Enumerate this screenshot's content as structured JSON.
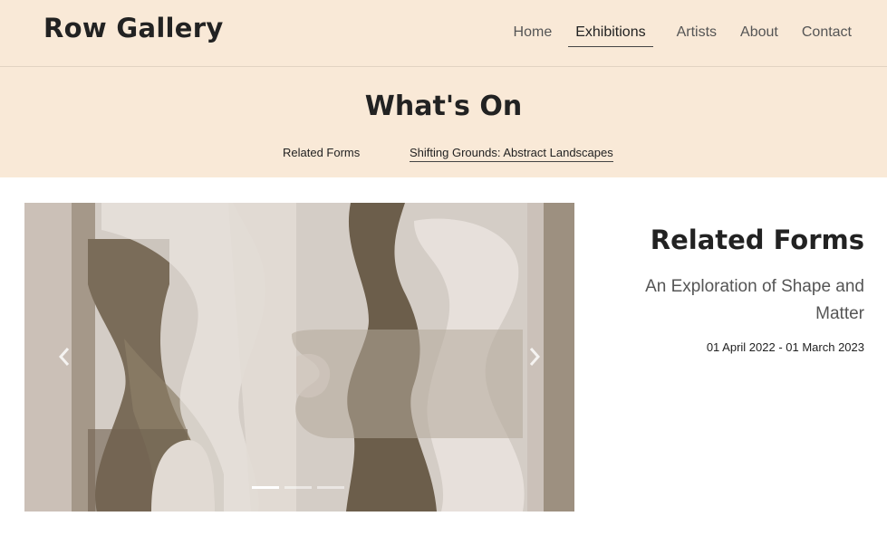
{
  "header": {
    "logo": "Row Gallery",
    "nav": [
      {
        "label": "Home"
      },
      {
        "label": "Exhibitions"
      },
      {
        "label": "Artists"
      },
      {
        "label": "About"
      },
      {
        "label": "Contact"
      }
    ],
    "active_nav": "Exhibitions"
  },
  "hero": {
    "title": "What's On",
    "tabs": [
      {
        "label": "Related Forms"
      },
      {
        "label": "Shifting Grounds: Abstract Landscapes"
      }
    ]
  },
  "carousel": {
    "slide_count": 3,
    "active_slide": 1,
    "prev_icon": "chevron-left-icon",
    "next_icon": "chevron-right-icon"
  },
  "exhibition": {
    "title": "Related Forms",
    "subtitle": "An Exploration of Shape and Matter",
    "dates": "01 April 2022 - 01 March 2023"
  },
  "colors": {
    "header_bg": "#f9e9d7",
    "text": "#222222"
  }
}
